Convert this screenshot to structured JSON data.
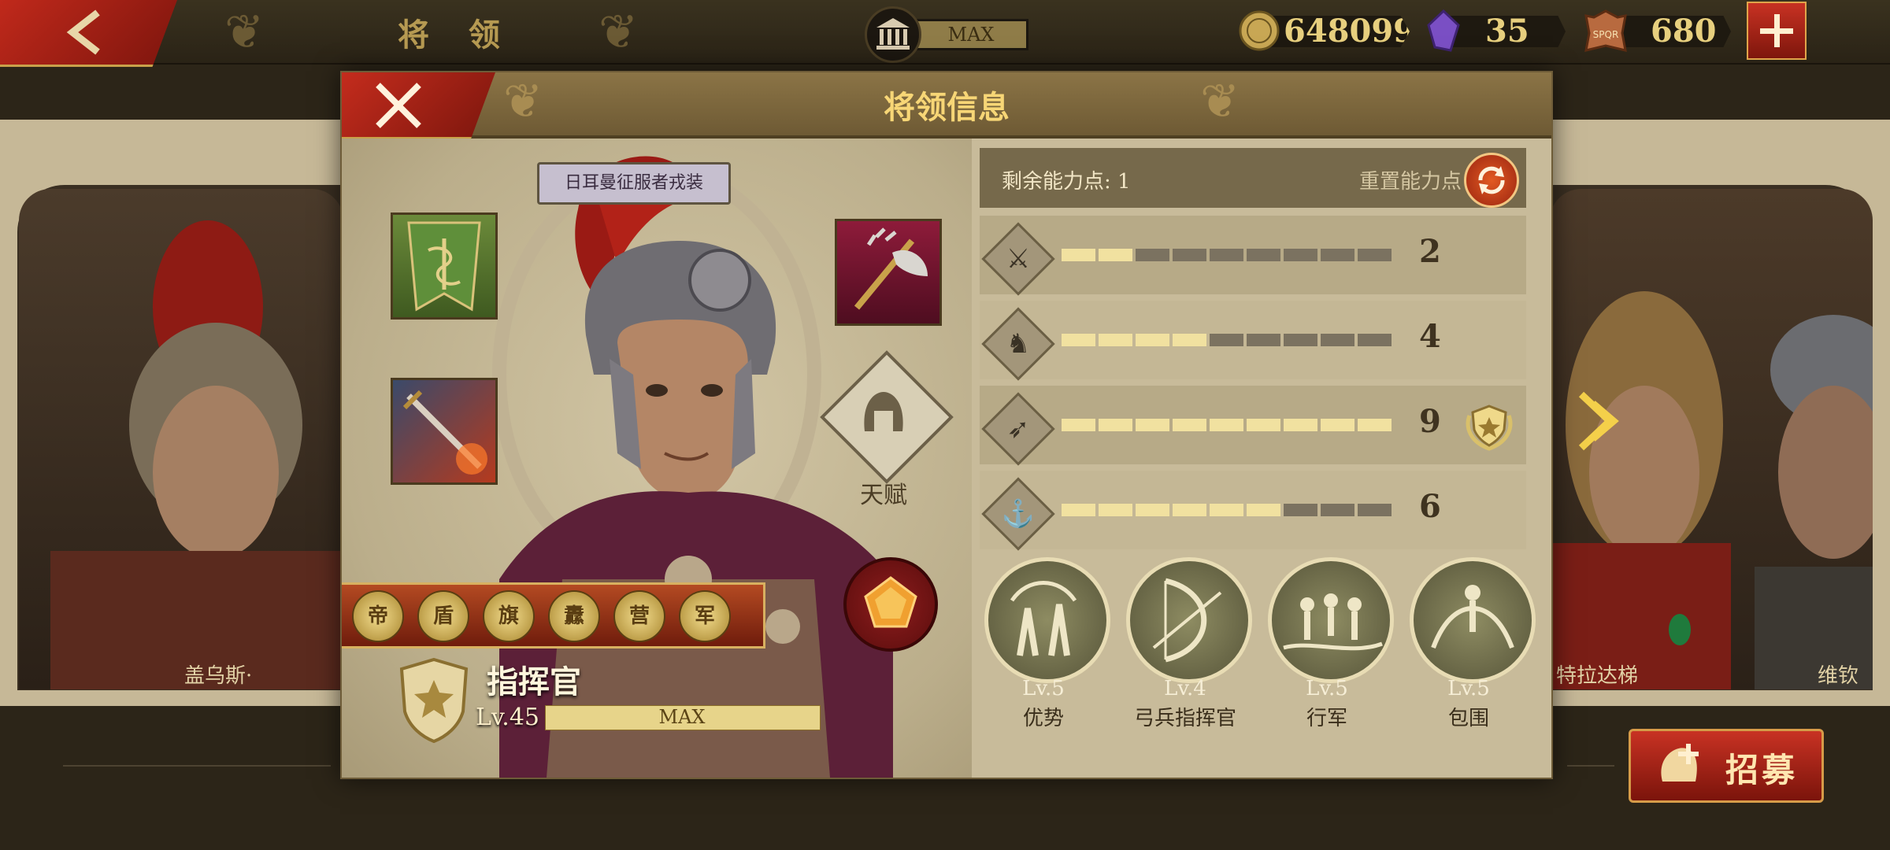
{
  "topbar": {
    "title": "将 领",
    "building_level": "MAX",
    "resources": [
      {
        "name": "coin-icon",
        "value": "648099",
        "color": "#c8a754"
      },
      {
        "name": "gem-icon",
        "value": "35",
        "color": "#7a4fc4"
      },
      {
        "name": "spqr-banner-icon",
        "value": "680",
        "color": "#c76a3a"
      }
    ]
  },
  "modal": {
    "title": "将领信息",
    "costume": "日耳曼征服者戎装",
    "talent_label": "天赋",
    "rank_title": "指挥官",
    "level": "Lv.45",
    "exp_label": "MAX",
    "exp_fraction": 1.0,
    "badges": [
      "帝",
      "盾",
      "旗",
      "纛",
      "营",
      "军"
    ],
    "points_label": "剩余能力点: 1",
    "reset_label": "重置能力点",
    "stats": [
      {
        "icon": "sword-icon",
        "value": "2",
        "level": 2,
        "max": 9
      },
      {
        "icon": "cavalry-horse-icon",
        "value": "4",
        "level": 4,
        "max": 9
      },
      {
        "icon": "bow-icon",
        "value": "9",
        "level": 9,
        "max": 9
      },
      {
        "icon": "anchor-icon",
        "value": "6",
        "level": 6,
        "max": 9
      }
    ],
    "skills": [
      {
        "level": "Lv.5",
        "name": "优势"
      },
      {
        "level": "Lv.4",
        "name": "弓兵指挥官"
      },
      {
        "level": "Lv.5",
        "name": "行军"
      },
      {
        "level": "Lv.5",
        "name": "包围"
      }
    ]
  },
  "background": {
    "left_hero_name": "盖乌斯·",
    "right_hero_name_1": "特拉达梯",
    "right_hero_name_2": "维钦托"
  },
  "recruit_label": "招募",
  "colors": {
    "accent_red": "#c0291b",
    "gold_text": "#f7d676",
    "bar_filled": "#f1e1a0",
    "bar_empty": "#7b7260"
  }
}
